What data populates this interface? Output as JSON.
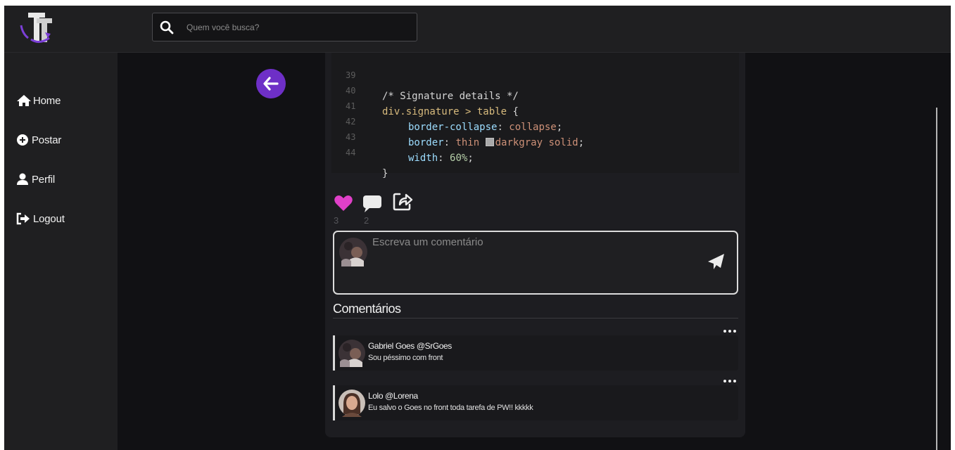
{
  "search": {
    "placeholder": "Quem você busca?"
  },
  "sidebar": {
    "items": [
      {
        "label": "Home",
        "icon": "home-icon"
      },
      {
        "label": "Postar",
        "icon": "plus-circle-icon"
      },
      {
        "label": "Perfil",
        "icon": "user-icon"
      },
      {
        "label": "Logout",
        "icon": "logout-icon"
      }
    ]
  },
  "post": {
    "code_lines": [
      {
        "num": "39",
        "text": "/* Signature details */"
      },
      {
        "num": "40",
        "selector": "div.signature > table",
        "brace": " {"
      },
      {
        "num": "41",
        "prop": "border-collapse",
        "value": "collapse"
      },
      {
        "num": "42",
        "prop": "border",
        "value": "thin",
        "value2": "darkgray solid"
      },
      {
        "num": "43",
        "prop": "width",
        "value": "60%"
      },
      {
        "num": "44",
        "text": "}"
      }
    ],
    "likes": "3",
    "comments_count": "2",
    "liked": true
  },
  "comment_input": {
    "placeholder": "Escreva um comentário"
  },
  "comments_section": {
    "title": "Comentários",
    "items": [
      {
        "author": "Gabriel Goes @SrGoes",
        "text": "Sou péssimo com front"
      },
      {
        "author": "Lolo @Lorena",
        "text": "Eu salvo o Goes no front toda tarefa de PW!! kkkkk"
      }
    ]
  },
  "colors": {
    "accent": "#6e2fc7",
    "like": "#e040c8",
    "background": "#111114",
    "panel": "#1f1f21"
  }
}
